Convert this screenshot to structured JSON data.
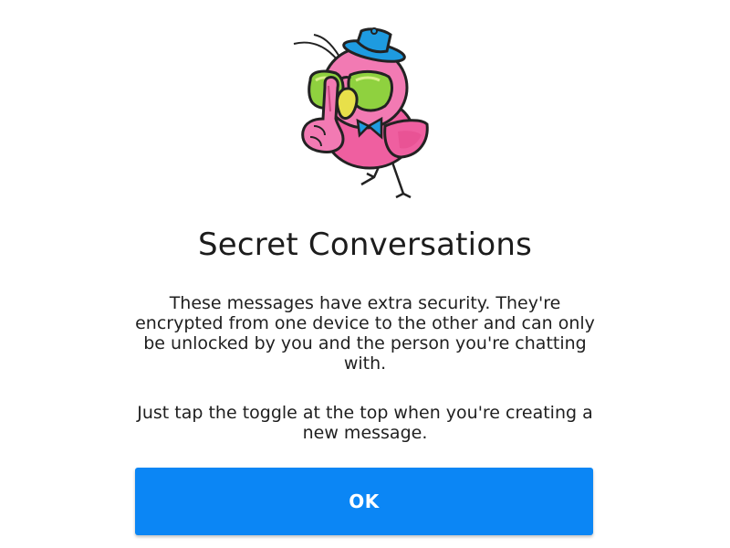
{
  "dialog": {
    "title": "Secret Conversations",
    "description": "These messages have extra security. They're encrypted from one device to the other and can only be unlocked by you and the person you're chatting with.",
    "instruction": "Just tap the toggle at the top when you're creating a new message.",
    "ok_label": "OK"
  },
  "illustration": {
    "icon": "secret-bird-icon"
  },
  "colors": {
    "button": "#0b86f5",
    "button_text": "#ffffff",
    "bird_pink": "#ef5fa0",
    "hat_blue": "#1e9be0",
    "glasses_green": "#8fd13f",
    "beak_yellow": "#e8e04a"
  }
}
